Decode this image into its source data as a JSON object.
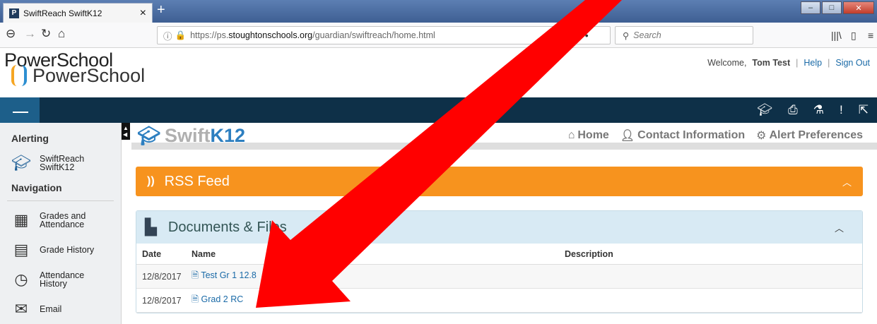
{
  "browser": {
    "tab_title": "SwiftReach SwiftK12",
    "url_prefix": "https://ps.",
    "url_host": "stoughtonschools.org",
    "url_path": "/guardian/swiftreach/home.html",
    "search_placeholder": "Search"
  },
  "header": {
    "logo_line1": "PowerSchool",
    "logo_line2": "PowerSchool",
    "welcome_prefix": "Welcome,",
    "user_name": "Tom Test",
    "help": "Help",
    "sign_out": "Sign Out"
  },
  "sidebar": {
    "alerting_heading": "Alerting",
    "swiftreach_label_1": "SwiftReach",
    "swiftreach_label_2": "SwiftK12",
    "navigation_heading": "Navigation",
    "items": [
      {
        "line1": "Grades and",
        "line2": "Attendance"
      },
      {
        "line1": "Grade History",
        "line2": ""
      },
      {
        "line1": "Attendance",
        "line2": "History"
      },
      {
        "line1": "Email",
        "line2": ""
      }
    ]
  },
  "swift": {
    "logo_swift": "Swift",
    "logo_k12": "K12",
    "nav_home": "Home",
    "nav_contact": "Contact Information",
    "nav_alert": "Alert Preferences"
  },
  "rss": {
    "title": "RSS Feed"
  },
  "documents": {
    "title": "Documents & Files",
    "columns": [
      "Date",
      "Name",
      "Description"
    ],
    "rows": [
      {
        "date": "12/8/2017",
        "name": "Test Gr 1 12.8",
        "description": ""
      },
      {
        "date": "12/8/2017",
        "name": "Grad 2 RC",
        "description": ""
      }
    ]
  },
  "colors": {
    "rss_orange": "#f7931e",
    "dark_bar": "#0e3048",
    "arrow_red": "#ff0000"
  }
}
